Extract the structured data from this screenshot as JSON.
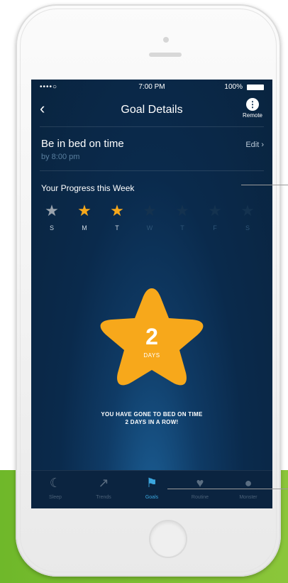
{
  "status": {
    "signal": "••••○",
    "wifi": "wifi-icon",
    "time": "7:00 PM",
    "battery": "100%"
  },
  "nav": {
    "title": "Goal Details",
    "remote_label": "Remote"
  },
  "goal": {
    "title": "Be in bed on time",
    "subtitle": "by 8:00 pm",
    "edit": "Edit ›"
  },
  "progress": {
    "title": "Your Progress this Week",
    "days": [
      {
        "label": "S",
        "state": "partial"
      },
      {
        "label": "M",
        "state": "achieved"
      },
      {
        "label": "T",
        "state": "achieved"
      },
      {
        "label": "W",
        "state": "future"
      },
      {
        "label": "T",
        "state": "future"
      },
      {
        "label": "F",
        "state": "future"
      },
      {
        "label": "S",
        "state": "future"
      }
    ]
  },
  "streak": {
    "value": "2",
    "unit": "DAYS",
    "message_line1": "YOU HAVE GONE TO BED ON TIME",
    "message_line2": "2 DAYS IN A ROW!"
  },
  "tabs": [
    {
      "label": "Sleep",
      "icon": "moon-icon"
    },
    {
      "label": "Trends",
      "icon": "trend-icon"
    },
    {
      "label": "Goals",
      "icon": "flag-icon",
      "active": true
    },
    {
      "label": "Routine",
      "icon": "heart-icon"
    },
    {
      "label": "Monster",
      "icon": "monster-icon"
    }
  ],
  "colors": {
    "background": "#09243f",
    "accent_star": "#f7a81b",
    "active_tab": "#3ba6de",
    "green_band": "#7cbf30"
  }
}
